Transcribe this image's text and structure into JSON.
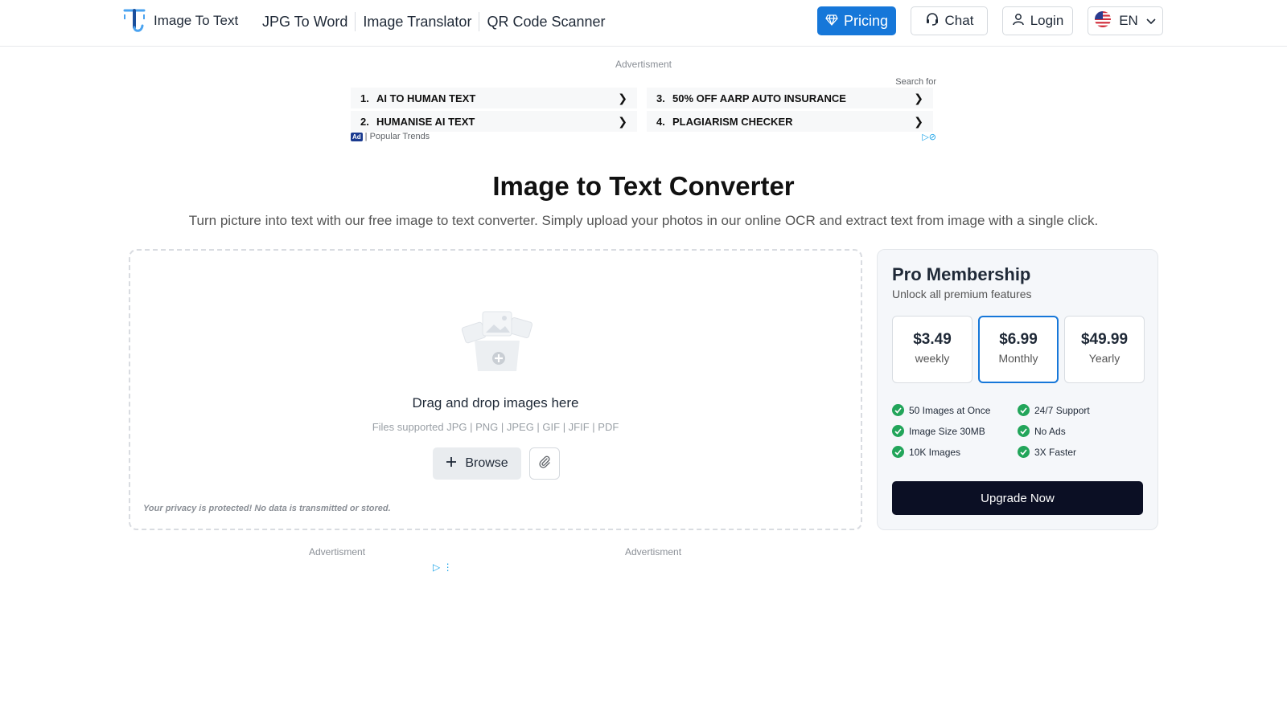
{
  "header": {
    "logo_text": "Image To Text",
    "nav": [
      "JPG To Word",
      "Image Translator",
      "QR Code Scanner"
    ],
    "pricing_label": "Pricing",
    "chat_label": "Chat",
    "login_label": "Login",
    "lang_label": "EN"
  },
  "top_ad": {
    "label": "Advertisment",
    "search_for": "Search for",
    "items": [
      {
        "num": "1.",
        "text": "AI TO HUMAN TEXT"
      },
      {
        "num": "2.",
        "text": "HUMANISE AI TEXT"
      },
      {
        "num": "3.",
        "text": "50% OFF AARP AUTO INSURANCE"
      },
      {
        "num": "4.",
        "text": "PLAGIARISM CHECKER"
      }
    ],
    "badge": "Ad",
    "footer": "| Popular Trends"
  },
  "hero": {
    "title": "Image to Text Converter",
    "subtitle": "Turn picture into text with our free image to text converter. Simply upload your photos in our online OCR and extract text from image with a single click."
  },
  "upload": {
    "title": "Drag and drop images here",
    "types": "Files supported JPG | PNG | JPEG | GIF | JFIF | PDF",
    "browse_label": "Browse",
    "privacy": "Your privacy is protected! No data is transmitted or stored."
  },
  "pro": {
    "title": "Pro Membership",
    "subtitle": "Unlock all premium features",
    "plans": [
      {
        "price": "$3.49",
        "period": "weekly"
      },
      {
        "price": "$6.99",
        "period": "Monthly"
      },
      {
        "price": "$49.99",
        "period": "Yearly"
      }
    ],
    "selected_plan": 1,
    "features": [
      "50 Images at Once",
      "24/7 Support",
      "Image Size 30MB",
      "No Ads",
      "10K Images",
      "3X Faster"
    ],
    "upgrade_label": "Upgrade Now"
  },
  "bottom_ads": {
    "left_label": "Advertisment",
    "right_label": "Advertisment"
  },
  "colors": {
    "primary": "#1677d9",
    "dark_button": "#0b0f24",
    "check_green": "#22a55a"
  }
}
